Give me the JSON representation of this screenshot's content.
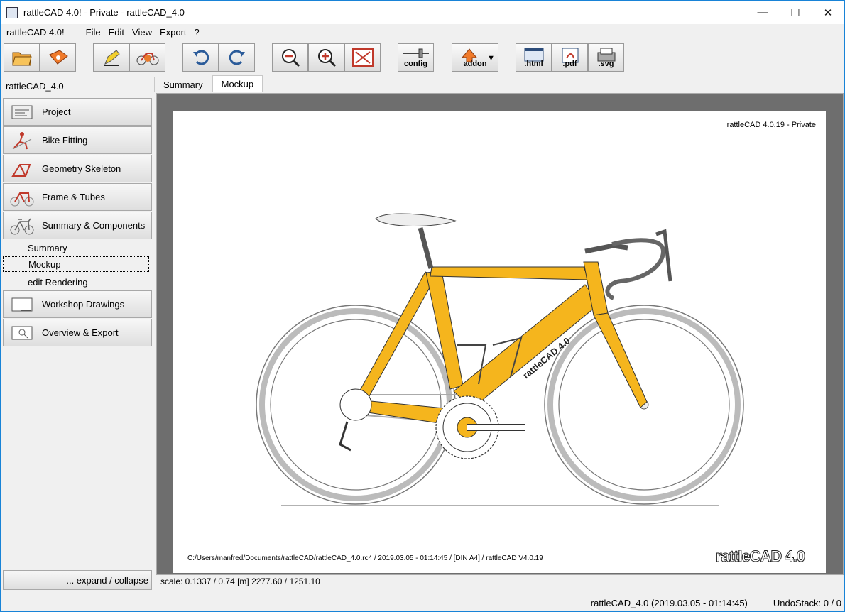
{
  "window": {
    "title": "rattleCAD 4.0!  - Private  - rattleCAD_4.0",
    "controls": [
      "—",
      "☐",
      "✕"
    ]
  },
  "menubar": {
    "brand": "rattleCAD 4.0!",
    "items": [
      "File",
      "Edit",
      "View",
      "Export",
      "?"
    ]
  },
  "toolbar": {
    "config_label": "config",
    "addon_label": "addon",
    "html_label": ".html",
    "pdf_label": ".pdf",
    "svg_label": ".svg"
  },
  "sidebar": {
    "header": "rattleCAD_4.0",
    "items": [
      {
        "label": "Project"
      },
      {
        "label": "Bike Fitting"
      },
      {
        "label": "Geometry Skeleton"
      },
      {
        "label": "Frame & Tubes"
      },
      {
        "label": "Summary & Components"
      }
    ],
    "subitems": [
      {
        "label": "Summary"
      },
      {
        "label": "Mockup"
      },
      {
        "label": "edit Rendering"
      }
    ],
    "items2": [
      {
        "label": "Workshop Drawings"
      },
      {
        "label": "Overview & Export"
      }
    ],
    "expand_label": "... expand / collapse"
  },
  "tabs": [
    {
      "label": "Summary"
    },
    {
      "label": "Mockup"
    }
  ],
  "paper": {
    "version": "rattleCAD 4.0.19 - Private",
    "footer": "C:/Users/manfred/Documents/rattleCAD/rattleCAD_4.0.rc4   /   2019.03.05 - 01:14:45   / [DIN A4] /   rattleCAD   V4.0.19",
    "logo": "rattleCAD 4.0",
    "frame_text": "rattleCAD 4.0"
  },
  "scale_line": "scale: 0.1337 / 0.74  [m]  2277.60 / 1251.10",
  "status": {
    "file": "rattleCAD_4.0 (2019.03.05 - 01:14:45)",
    "undo": "UndoStack:  0 /  0"
  },
  "colors": {
    "frame": "#f5b51d",
    "accent": "#1883d7"
  }
}
